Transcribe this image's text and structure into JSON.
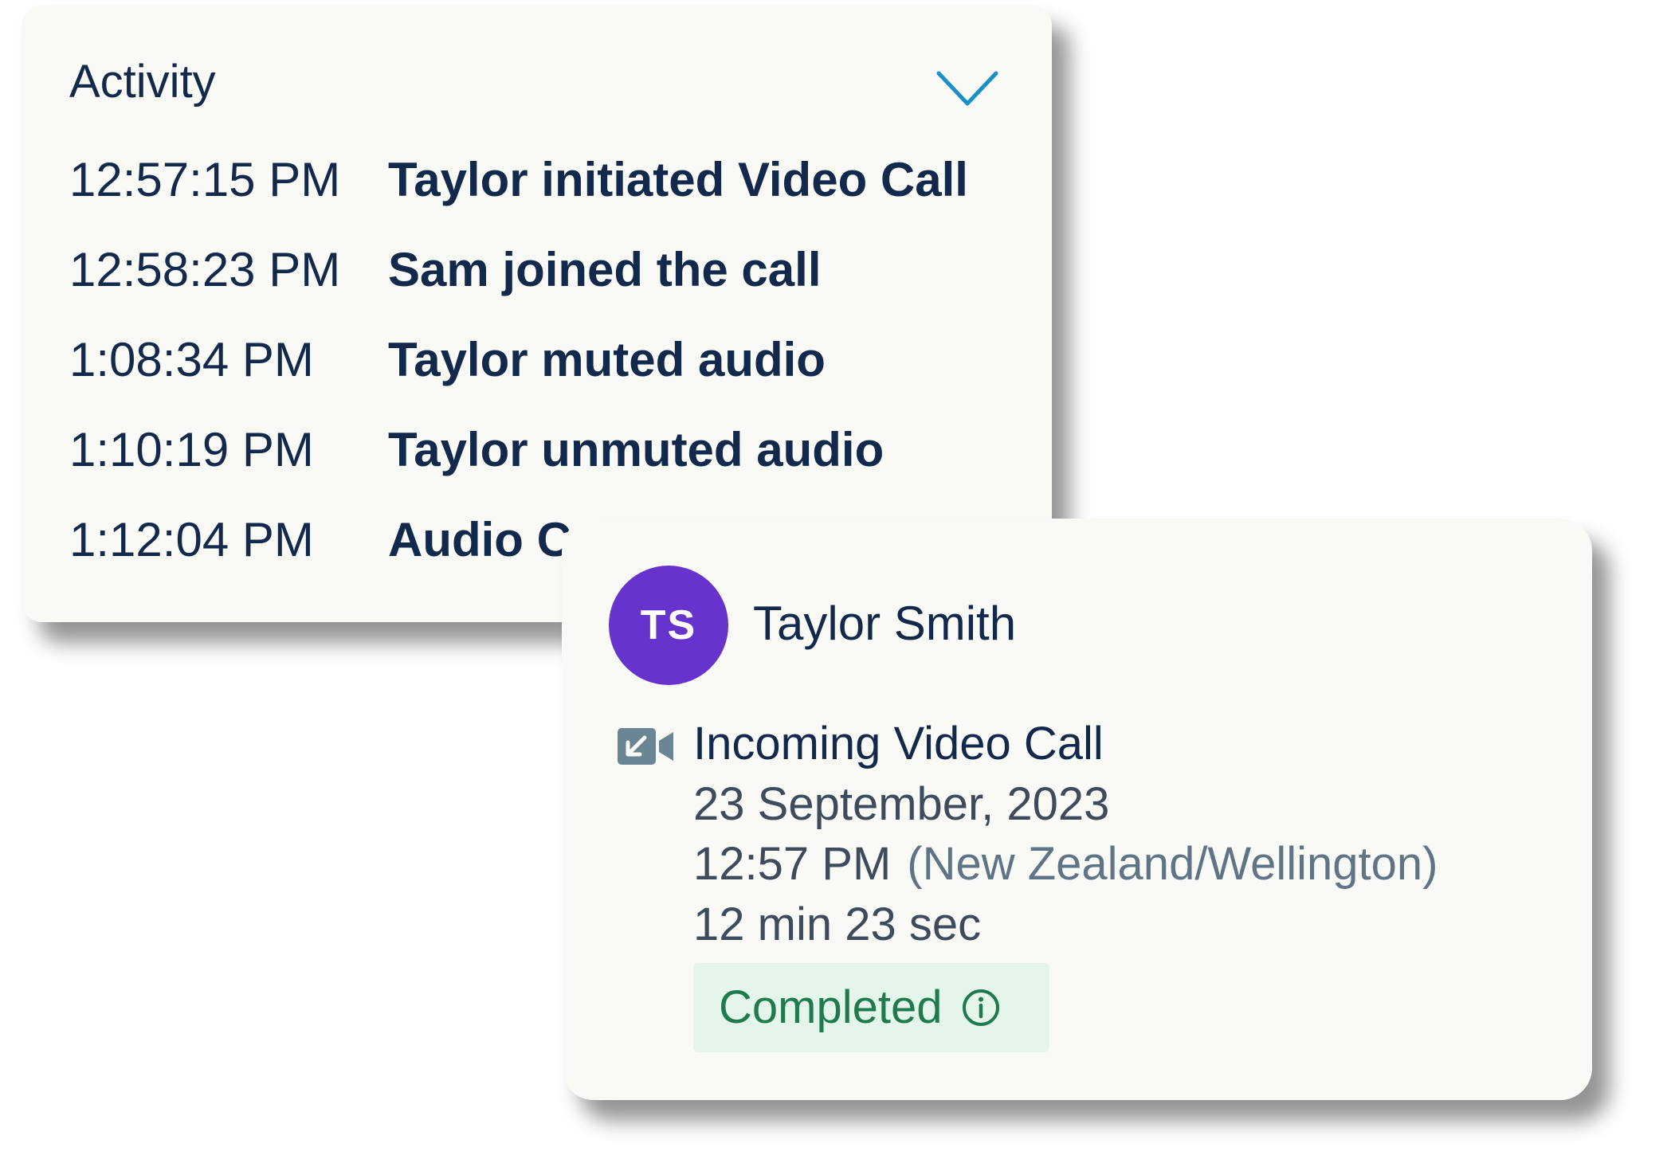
{
  "activity": {
    "title": "Activity",
    "toggle_icon": "chevron-down-icon",
    "entries": [
      {
        "time": "12:57:15 PM",
        "event": "Taylor initiated Video Call"
      },
      {
        "time": "12:58:23 PM",
        "event": "Sam joined the call"
      },
      {
        "time": "1:08:34 PM",
        "event": "Taylor muted audio"
      },
      {
        "time": "1:10:19 PM",
        "event": "Taylor unmuted audio"
      },
      {
        "time": "1:12:04 PM",
        "event": "Audio C"
      }
    ]
  },
  "call": {
    "contact": {
      "initials": "TS",
      "name": "Taylor Smith"
    },
    "type_icon": "incoming-video-call-icon",
    "type": "Incoming Video Call",
    "date": "23 September, 2023",
    "time": "12:57 PM",
    "timezone": "(New Zealand/Wellington)",
    "duration": "12 min 23 sec",
    "status": "Completed",
    "status_icon": "info-icon"
  },
  "colors": {
    "card_background": "#f9f9f6",
    "text_primary": "#13294b",
    "text_secondary": "#3d4b5c",
    "timezone_text": "#5f7485",
    "accent_chevron": "#1b8fc7",
    "avatar": "#6633cc",
    "status_background": "#e4f5ea",
    "status_text": "#1f7a4d",
    "call_icon": "#6a8593"
  }
}
